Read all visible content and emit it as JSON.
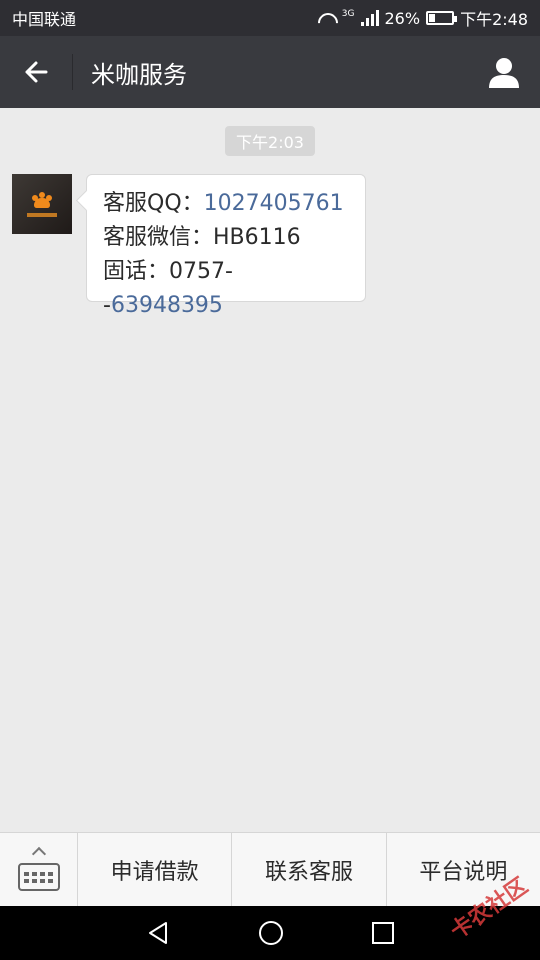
{
  "status_bar": {
    "carrier": "中国联通",
    "network": "3G",
    "battery": "26%",
    "time": "下午2:48"
  },
  "nav": {
    "title": "米咖服务"
  },
  "chat": {
    "timestamp": "下午2:03",
    "message": {
      "qq_label": "客服QQ：",
      "qq_value": "1027405761",
      "wechat_label": "客服微信：",
      "wechat_value": "HB6116",
      "phone_label": "固话：",
      "phone_prefix": "0757--",
      "phone_value": "63948395"
    }
  },
  "menu": {
    "items": [
      "申请借款",
      "联系客服",
      "平台说明"
    ]
  },
  "colors": {
    "status_bg": "#2e2e33",
    "nav_bg": "#393a3f",
    "chat_bg": "#ebebeb",
    "link": "#4a6a9a"
  }
}
